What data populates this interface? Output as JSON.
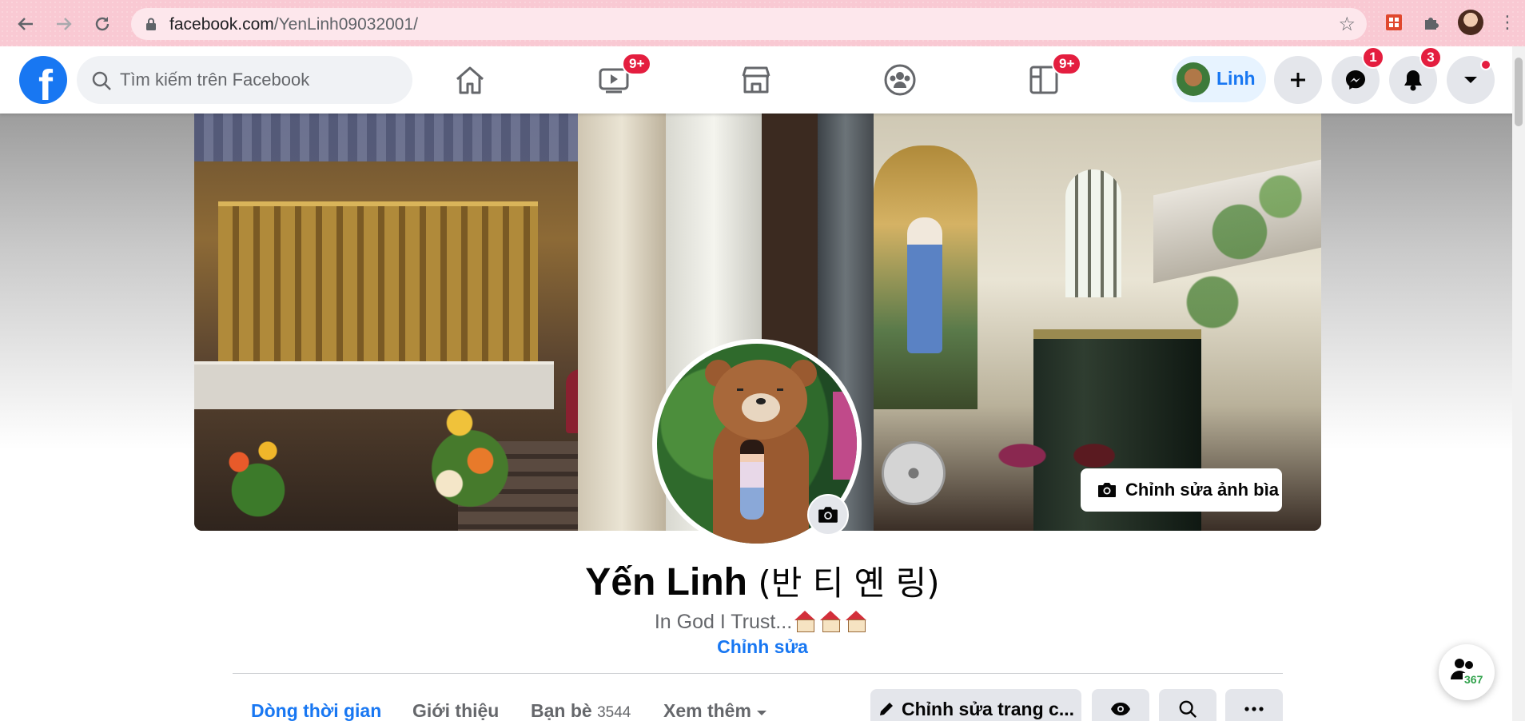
{
  "browser": {
    "url_domain": "facebook.com",
    "url_path": "/YenLinh09032001/"
  },
  "topbar": {
    "logo": "f",
    "search_placeholder": "Tìm kiếm trên Facebook",
    "watch_badge": "9+",
    "gaming_badge": "9+",
    "profile_name": "Linh",
    "messenger_badge": "1",
    "notifications_badge": "3"
  },
  "cover": {
    "edit_label": "Chỉnh sửa ảnh bìa"
  },
  "profile": {
    "name": "Yến Linh",
    "alternate_name": "(반 티 옌 링)",
    "bio": "In God I Trust...",
    "edit_bio_label": "Chỉnh sửa"
  },
  "tabs": {
    "timeline": "Dòng thời gian",
    "about": "Giới thiệu",
    "friends": "Bạn bè",
    "friends_count": "3544",
    "more": "Xem thêm",
    "edit_profile": "Chỉnh sửa trang c..."
  },
  "contacts_float": {
    "count": "367"
  },
  "colors": {
    "brand": "#1877f2",
    "badge": "#e41e3f",
    "chrome": "#f9c9d3"
  }
}
